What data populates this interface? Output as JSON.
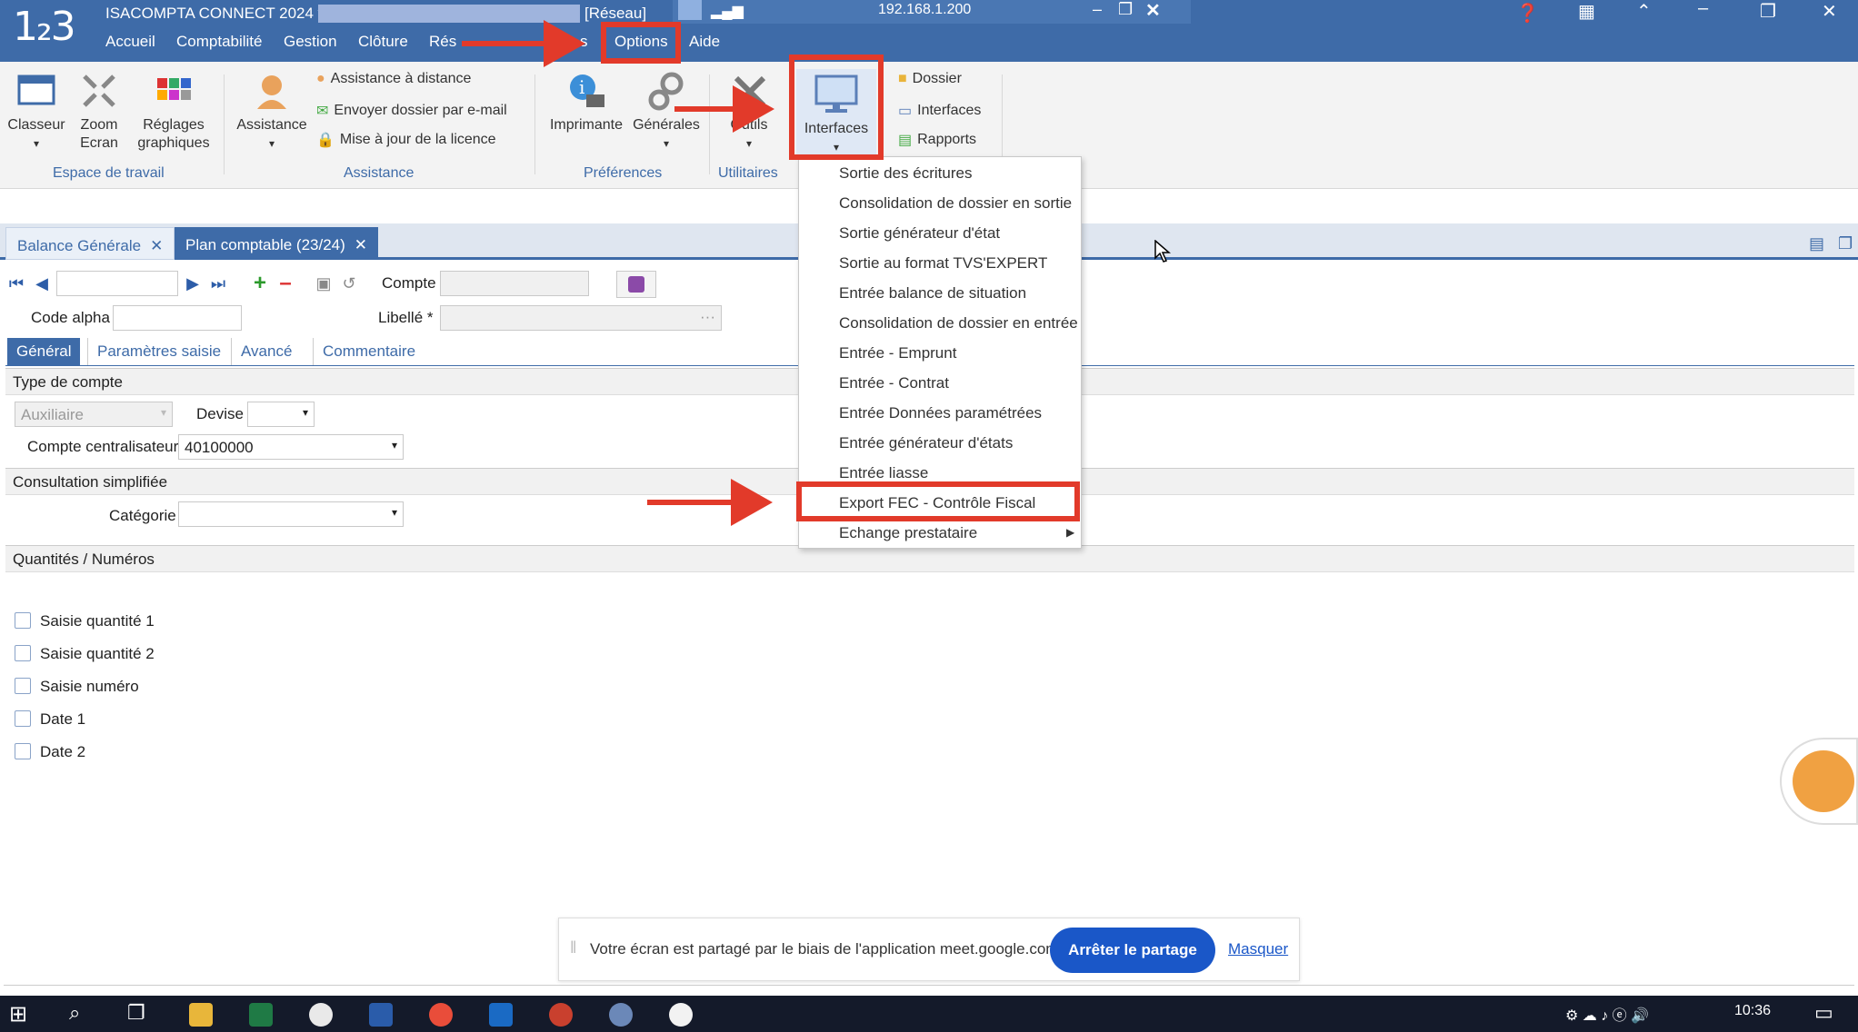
{
  "titlebar": {
    "logo": "1₂3",
    "app_title": "ISACOMPTA CONNECT 2024 v2",
    "network": "[Réseau]",
    "ip": "192.168.1.200"
  },
  "menubar": [
    "Accueil",
    "Comptabilité",
    "Gestion",
    "Clôture",
    "Rés",
    "s",
    "Options",
    "Aide"
  ],
  "ribbon": {
    "classeur": "Classeur",
    "zoom": "Zoom",
    "zoom2": "Ecran",
    "reglages": "Réglages",
    "reglages2": "graphiques",
    "group_workspace": "Espace de travail",
    "assistance": "Assistance",
    "assist_remote": "Assistance à distance",
    "assist_email": "Envoyer dossier par e-mail",
    "assist_licence": "Mise à jour de la licence",
    "group_assistance": "Assistance",
    "imprimante": "Imprimante",
    "generales": "Générales",
    "group_prefs": "Préférences",
    "outils": "Outils",
    "group_utils": "Utilitaires",
    "interfaces": "Interfaces",
    "dossier": "Dossier",
    "interfaces_small": "Interfaces",
    "rapports": "Rapports"
  },
  "doc_tabs": [
    "Balance Générale",
    "Plan comptable (23/24)"
  ],
  "form": {
    "compte_label": "Compte",
    "code_alpha_label": "Code alpha",
    "libelle_label": "Libellé *",
    "subtabs": [
      "Général",
      "Paramètres saisie",
      "Avancé",
      "Commentaire"
    ],
    "section_type": "Type de compte",
    "type_value": "Auxiliaire",
    "devise_label": "Devise",
    "centralisateur_label": "Compte centralisateur",
    "centralisateur_value": "40100000",
    "section_consult": "Consultation simplifiée",
    "categorie_label": "Catégorie",
    "section_qty": "Quantités / Numéros",
    "checkboxes": [
      "Saisie quantité 1",
      "Saisie quantité 2",
      "Saisie numéro",
      "Date 1",
      "Date 2"
    ]
  },
  "dropdown": [
    "Sortie des écritures",
    "Consolidation de dossier en sortie",
    "Sortie générateur d'état",
    "Sortie au format TVS'EXPERT",
    "Entrée balance de situation",
    "Consolidation de dossier en entrée",
    "Entrée - Emprunt",
    "Entrée - Contrat",
    "Entrée Données paramétrées",
    "Entrée générateur d'états",
    "Entrée liasse",
    "Export FEC - Contrôle Fiscal",
    "Echange prestataire"
  ],
  "sharebar": {
    "message": "Votre écran est partagé par le biais de l'application meet.google.com.",
    "stop": "Arrêter le partage",
    "hide": "Masquer"
  },
  "taskbar": {
    "time": "10:36"
  },
  "colors": {
    "accent": "#3e6ba8",
    "annotation": "#e23a2a",
    "share_button": "#1a57c8"
  }
}
